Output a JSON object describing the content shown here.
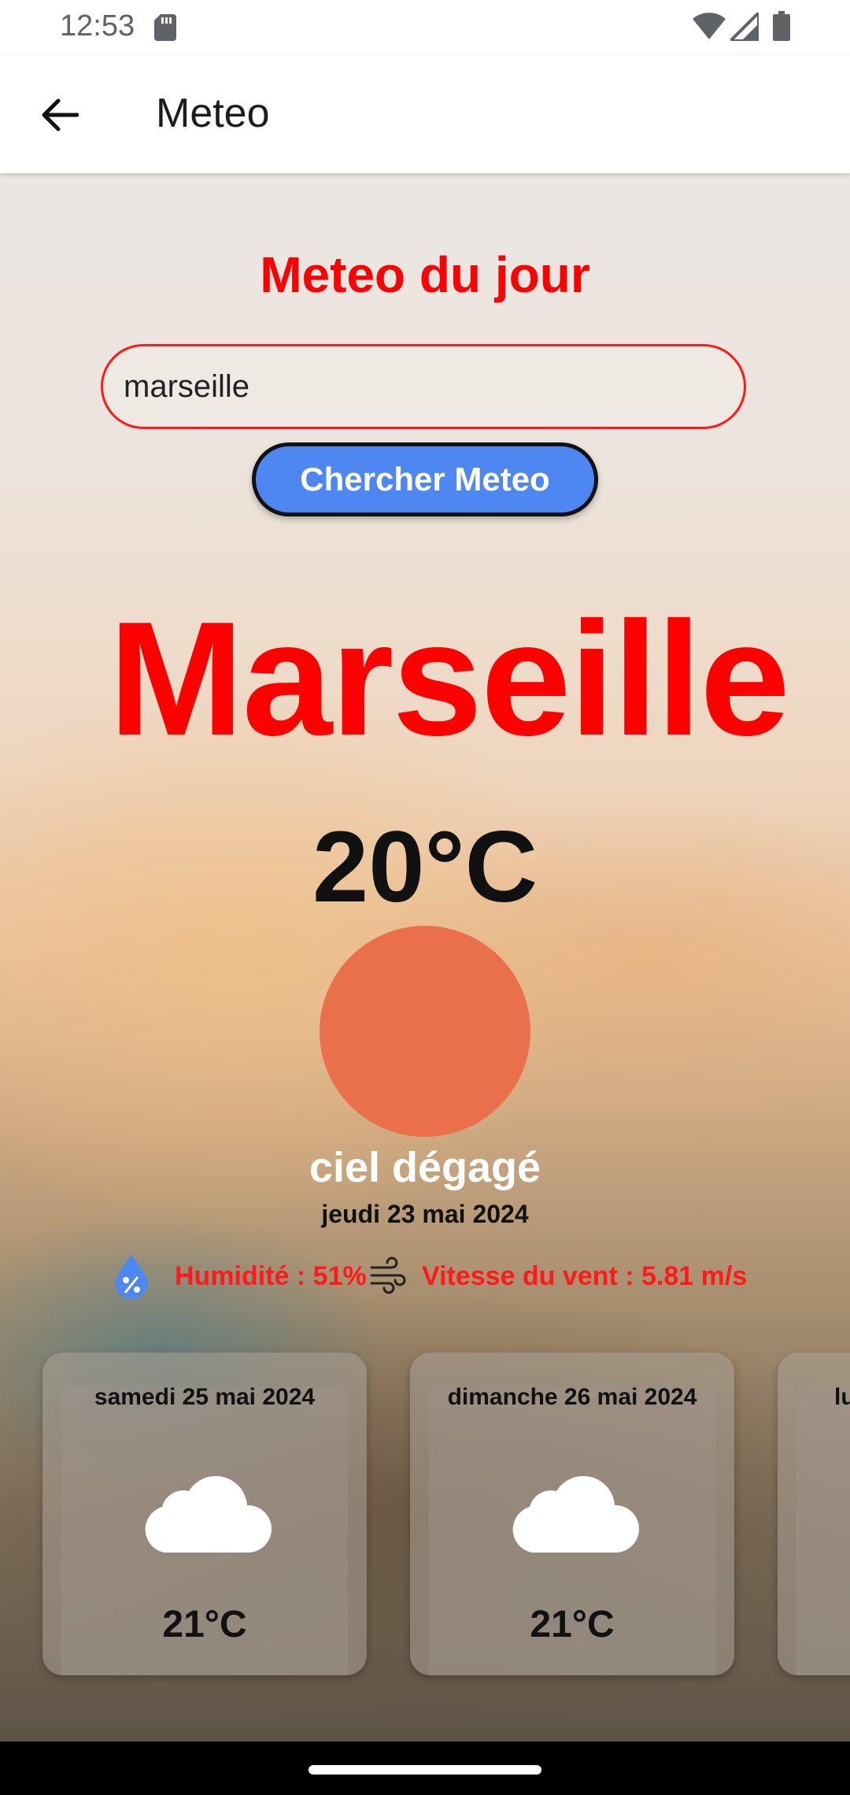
{
  "status_bar": {
    "time": "12:53",
    "icons": [
      "sd-card-icon",
      "wifi-icon",
      "signal-icon",
      "battery-icon"
    ]
  },
  "app_bar": {
    "title": "Meteo",
    "back_icon": "arrow-left-icon"
  },
  "main": {
    "heading": "Meteo du jour",
    "search": {
      "value": "marseille",
      "placeholder": ""
    },
    "search_button_label": "Chercher Meteo",
    "city": "Marseille",
    "temperature": "20°C",
    "weather_icon": "sun-circle-icon",
    "description": "ciel dégagé",
    "date": "jeudi 23 mai 2024",
    "humidity": "Humidité : 51%",
    "wind": "Vitesse du vent : 5.81 m/s"
  },
  "forecast": [
    {
      "date": "samedi 25 mai 2024",
      "temp": "21°C",
      "icon": "cloud-icon"
    },
    {
      "date": "dimanche 26 mai 2024",
      "temp": "21°C",
      "icon": "cloud-icon"
    },
    {
      "date": "lu",
      "temp": "",
      "icon": ""
    }
  ],
  "colors": {
    "accent_red": "#ff0000",
    "button_blue": "#4f87f2",
    "sun_orange": "#ea704b"
  }
}
